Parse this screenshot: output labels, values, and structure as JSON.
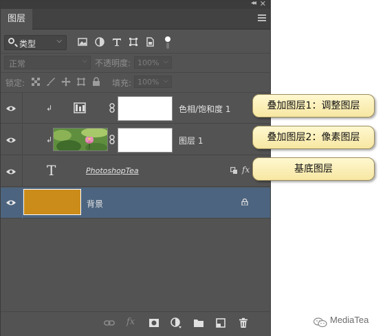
{
  "panel": {
    "tab_label": "图层",
    "filter_label": "类型",
    "blend_mode": "正常",
    "opacity_label": "不透明度:",
    "opacity_value": "100%",
    "lock_label": "锁定:",
    "fill_label": "填充:",
    "fill_value": "100%"
  },
  "layers": [
    {
      "name": "色相/饱和度 1",
      "kind": "adjustment",
      "clipped": true
    },
    {
      "name": "图层 1",
      "kind": "pixel",
      "clipped": true
    },
    {
      "name": "PhotoshopTea",
      "kind": "text",
      "effects_label": "fx"
    },
    {
      "name": "背景",
      "kind": "background",
      "selected": true,
      "color": "#cc8c1a"
    }
  ],
  "callouts": [
    {
      "text": "叠加图层1：调整图层"
    },
    {
      "text": "叠加图层2：像素图层"
    },
    {
      "text": "基底图层"
    }
  ],
  "bottom_bar": {
    "fx_label": "fx"
  },
  "watermark": {
    "text": "MediaTea"
  },
  "colors": {
    "panel": "#535353",
    "selected_row": "#4c647f",
    "callout_fill": "#fbefb8"
  }
}
